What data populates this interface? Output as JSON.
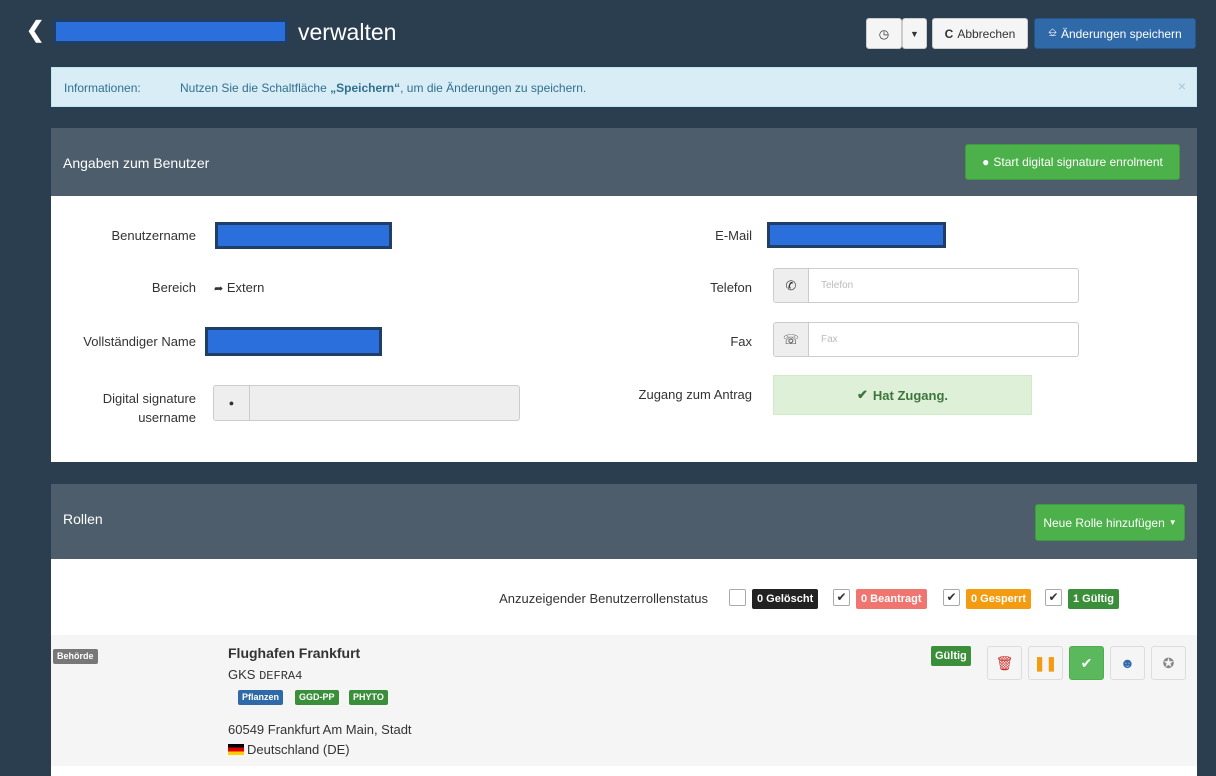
{
  "header": {
    "title_suffix": "verwalten",
    "history_icon": "clock-icon",
    "cancel_label": "Abbrechen",
    "save_label": "Änderungen speichern"
  },
  "info": {
    "label": "Informationen:",
    "message_prefix": "Nutzen Sie die Schaltfläche",
    "message_keyword": "„Speichern“",
    "message_suffix": ", um die Änderungen zu speichern.",
    "close": "×"
  },
  "user_panel": {
    "title": "Angaben zum Benutzer",
    "enrol_label": "Start digital signature enrolment",
    "fields": {
      "username_label": "Benutzername",
      "area_label": "Bereich",
      "area_value": "Extern",
      "fullname_label": "Vollständiger Name",
      "sig_label_1": "Digital signature",
      "sig_label_2": "username",
      "email_label": "E-Mail",
      "phone_label": "Telefon",
      "phone_placeholder": "Telefon",
      "fax_label": "Fax",
      "fax_placeholder": "Fax",
      "access_label": "Zugang zum Antrag",
      "access_value": "Hat Zugang."
    }
  },
  "roles_panel": {
    "title": "Rollen",
    "add_role_label": "Neue Rolle hinzufügen",
    "filter_label": "Anzuzeigender Benutzerrollenstatus",
    "filters": {
      "deleted": "0 Gelöscht",
      "requested": "0 Beantragt",
      "locked": "0 Gesperrt",
      "valid": "1 Gültig"
    },
    "role": {
      "type": "Behörde",
      "name": "Flughafen Frankfurt",
      "gks_prefix": "GKS",
      "gks_code": "DEFRA4",
      "tags": [
        "Pflanzen",
        "GGD-PP",
        "PHYTO"
      ],
      "address": "60549 Frankfurt Am Main, Stadt",
      "country": "Deutschland (DE)",
      "status": "Gültig"
    }
  },
  "colors": {
    "dark_bg": "#2b3e50",
    "panel_head": "#4e5d6c",
    "primary": "#3069a8",
    "success": "#4cb14a",
    "danger": "#f0746f",
    "warning": "#f39c12",
    "info_bg": "#d9edf7"
  }
}
